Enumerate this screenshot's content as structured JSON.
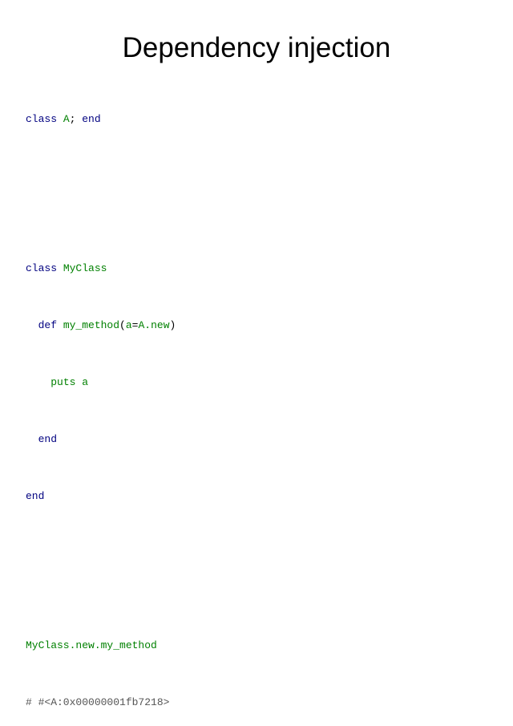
{
  "title": "Dependency injection",
  "colors": {
    "keyword": "#000080",
    "identifier": "#008000",
    "plain": "#000000",
    "comment": "#555555"
  },
  "code": {
    "l1": {
      "kw1": "class",
      "sp1": " ",
      "name": "A",
      "semi": "; ",
      "kw2": "end"
    },
    "l2": {
      "kw": "class",
      "sp": " ",
      "name": "MyClass"
    },
    "l3": {
      "indent": "  ",
      "kw": "def",
      "sp": " ",
      "method": "my_method",
      "paren_open": "(",
      "param": "a",
      "eq": "=",
      "default": "A.new",
      "paren_close": ")"
    },
    "l4": {
      "indent": "    ",
      "text": "puts a"
    },
    "l5": {
      "indent": "  ",
      "kw": "end"
    },
    "l6": {
      "kw": "end"
    },
    "l7": {
      "call": "MyClass.new.my_method"
    },
    "l8": {
      "comment": "# #<A:0x00000001fb7218>"
    }
  }
}
